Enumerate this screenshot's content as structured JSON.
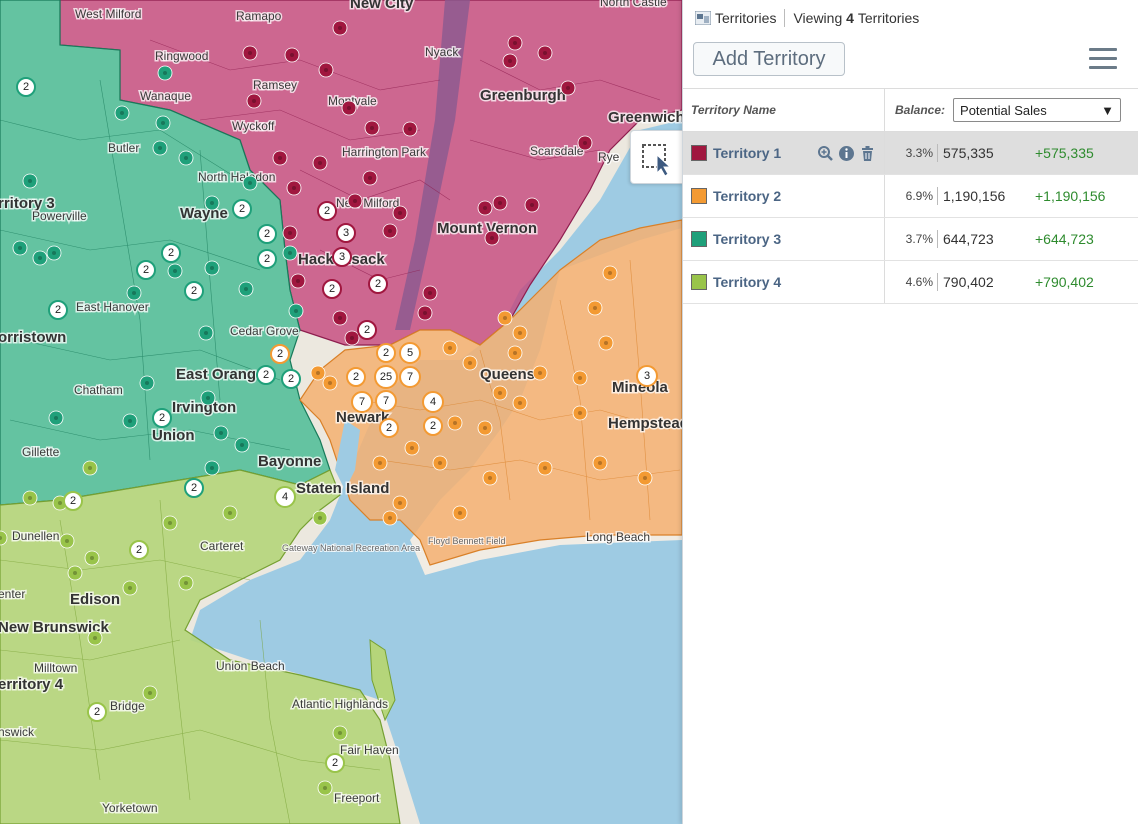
{
  "map": {
    "labels": {
      "west_milford": "West Milford",
      "ramapo": "Ramapo",
      "new_city": "New City",
      "north_castle": "North Castle",
      "ringwood": "Ringwood",
      "nyack": "Nyack",
      "ramsey": "Ramsey",
      "wanaque": "Wanaque",
      "montvale": "Montvale",
      "greenburgh": "Greenburgh",
      "greenwich": "Greenwich",
      "wyckoff": "Wyckoff",
      "harrington_park": "Harrington Park",
      "scarsdale": "Scarsdale",
      "rye": "Rye",
      "butler": "Butler",
      "north_haledon": "North Haledon",
      "territory_3": "rritory 3",
      "powerville": "Powerville",
      "new_milford": "New Milford",
      "wayne": "Wayne",
      "mount_vernon": "Mount Vernon",
      "hackensack": "Hackensack",
      "east_hanover": "East Hanover",
      "cedar_grove": "Cedar Grove",
      "morristown": "orristown",
      "east_orange": "East Orange",
      "queens": "Queens",
      "mineola": "Mineola",
      "chatham": "Chatham",
      "irvington": "Irvington",
      "union": "Union",
      "newark": "Newark",
      "hempstead": "Hempstead",
      "gillette": "Gillette",
      "bayonne": "Bayonne",
      "staten_island": "Staten Island",
      "dunellen": "Dunellen",
      "carteret": "Carteret",
      "gateway": "Gateway National Recreation Area",
      "floyd_bennett": "Floyd Bennett Field",
      "long_beach": "Long Beach",
      "edison": "Edison",
      "new_brunswick": "New Brunswick",
      "union_beach": "Union Beach",
      "milltown": "Milltown",
      "territory_4": "erritory 4",
      "bridge": "Bridge",
      "atlantic_highlands": "Atlantic Highlands",
      "fair_haven": "Fair Haven",
      "yorketown": "Yorketown",
      "freeport": "Freeport",
      "center": "enter",
      "brunswick": "nswick"
    },
    "clusters": {
      "c1": "2",
      "c2": "2",
      "c3": "2",
      "c4": "2",
      "c5": "2",
      "c6": "2",
      "c7": "3",
      "c8": "3",
      "c9": "2",
      "c10": "2",
      "c11": "2",
      "c12": "2",
      "c13": "2",
      "c14": "2",
      "c15": "2",
      "c16": "5",
      "c17": "25",
      "c18": "7",
      "c19": "2",
      "c20": "7",
      "c21": "7",
      "c22": "4",
      "c23": "2",
      "c24": "2",
      "c25": "3",
      "c26": "2",
      "c27": "2",
      "c28": "4",
      "c29": "2",
      "c30": "2",
      "c31": "2",
      "c32": "2",
      "c33": "2",
      "c34": "2",
      "c35": "2"
    }
  },
  "panel": {
    "title": "Territories",
    "viewing_prefix": "Viewing",
    "viewing_count": "4",
    "viewing_suffix": "Territories",
    "add_button": "Add Territory",
    "col_name": "Territory Name",
    "col_balance": "Balance:",
    "balance_selected": "Potential Sales",
    "rows": [
      {
        "name": "Territory 1",
        "color": "#a0173f",
        "pct": "3.3%",
        "value": "575,335",
        "delta": "+575,335",
        "selected": true
      },
      {
        "name": "Territory 2",
        "color": "#f39a33",
        "pct": "6.9%",
        "value": "1,190,156",
        "delta": "+1,190,156",
        "selected": false
      },
      {
        "name": "Territory 3",
        "color": "#1fa07a",
        "pct": "3.7%",
        "value": "644,723",
        "delta": "+644,723",
        "selected": false
      },
      {
        "name": "Territory 4",
        "color": "#99c44a",
        "pct": "4.6%",
        "value": "790,402",
        "delta": "+790,402",
        "selected": false
      }
    ]
  },
  "colors": {
    "water": "#9ecbe3",
    "territory_1": "#c4427a",
    "territory_2": "#f5b071",
    "territory_3": "#3db98f",
    "territory_4": "#b5d57a",
    "positive": "#2e8b2e"
  }
}
